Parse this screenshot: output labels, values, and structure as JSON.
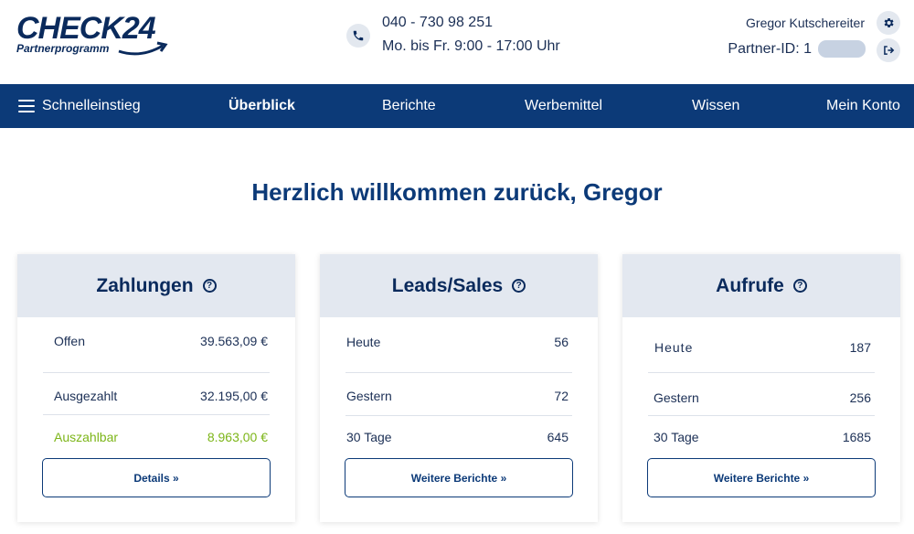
{
  "header": {
    "logo_text": "CHECK24",
    "logo_sub": "Partnerprogramm",
    "phone": "040 - 730 98 251",
    "hours": "Mo. bis Fr. 9:00 - 17:00 Uhr",
    "user_name": "Gregor Kutschereiter",
    "partner_id_label": "Partner-ID: 1"
  },
  "nav": {
    "items": [
      {
        "label": "Schnelleinstieg"
      },
      {
        "label": "Überblick"
      },
      {
        "label": "Berichte"
      },
      {
        "label": "Werbemittel"
      },
      {
        "label": "Wissen"
      },
      {
        "label": "Mein Konto"
      }
    ]
  },
  "welcome": "Herzlich willkommen zurück, Gregor",
  "cards": [
    {
      "title": "Zahlungen",
      "rows": [
        {
          "label": "Offen",
          "value": "39.563,09 €"
        },
        {
          "label": "Ausgezahlt",
          "value": "32.195,00 €"
        },
        {
          "label": "Auszahlbar",
          "value": "8.963,00 €"
        }
      ],
      "button": "Details »"
    },
    {
      "title": "Leads/Sales",
      "rows": [
        {
          "label": "Heute",
          "value": "56"
        },
        {
          "label": "Gestern",
          "value": "72"
        },
        {
          "label": "30 Tage",
          "value": "645"
        }
      ],
      "button": "Weitere Berichte »"
    },
    {
      "title": "Aufrufe",
      "rows": [
        {
          "label": "Heute",
          "value": "187"
        },
        {
          "label": "Gestern",
          "value": "256"
        },
        {
          "label": "30 Tage",
          "value": "1685"
        }
      ],
      "button": "Weitere Berichte »"
    }
  ],
  "icons": {
    "phone": "phone-icon",
    "settings": "gear-icon",
    "logout": "logout-icon",
    "menu": "hamburger-icon",
    "help": "question-icon"
  },
  "colors": {
    "brand": "#0c3a78",
    "positive": "#7cb518"
  }
}
